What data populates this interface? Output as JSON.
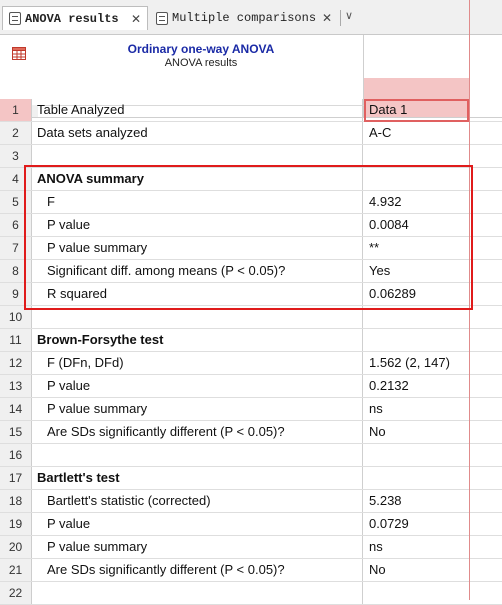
{
  "tabs": [
    {
      "label": "ANOVA results",
      "active": true,
      "icon": "table-icon"
    },
    {
      "label": "Multiple comparisons",
      "active": false,
      "icon": "table-icon"
    }
  ],
  "tab_close_glyph": "✕",
  "tab_menu_glyph": "∨",
  "header": {
    "title": "Ordinary one-way ANOVA",
    "subtitle": "ANOVA results",
    "corner_icon": "grid-table-icon"
  },
  "colors": {
    "accent_text": "#1a2aa6",
    "selected_row": "#f4c5c5",
    "highlight_border": "#e01b1b"
  },
  "rows": [
    {
      "num": "1",
      "label": "Table Analyzed",
      "value": "Data 1",
      "style": "plain",
      "selected": true
    },
    {
      "num": "2",
      "label": "Data sets analyzed",
      "value": "A-C",
      "style": "plain"
    },
    {
      "num": "3",
      "label": "",
      "value": "",
      "style": "plain"
    },
    {
      "num": "4",
      "label": "ANOVA summary",
      "value": "",
      "style": "head"
    },
    {
      "num": "5",
      "label": "F",
      "value": "4.932",
      "style": "sub"
    },
    {
      "num": "6",
      "label": "P value",
      "value": "0.0084",
      "style": "sub"
    },
    {
      "num": "7",
      "label": "P value summary",
      "value": "**",
      "style": "sub"
    },
    {
      "num": "8",
      "label": "Significant diff. among means (P < 0.05)?",
      "value": "Yes",
      "style": "sub"
    },
    {
      "num": "9",
      "label": "R squared",
      "value": "0.06289",
      "style": "sub"
    },
    {
      "num": "10",
      "label": "",
      "value": "",
      "style": "plain"
    },
    {
      "num": "11",
      "label": "Brown-Forsythe test",
      "value": "",
      "style": "head"
    },
    {
      "num": "12",
      "label": "F (DFn, DFd)",
      "value": "1.562 (2, 147)",
      "style": "sub"
    },
    {
      "num": "13",
      "label": "P value",
      "value": "0.2132",
      "style": "sub"
    },
    {
      "num": "14",
      "label": "P value summary",
      "value": "ns",
      "style": "sub"
    },
    {
      "num": "15",
      "label": "Are SDs significantly different (P < 0.05)?",
      "value": "No",
      "style": "sub"
    },
    {
      "num": "16",
      "label": "",
      "value": "",
      "style": "plain"
    },
    {
      "num": "17",
      "label": "Bartlett's test",
      "value": "",
      "style": "head"
    },
    {
      "num": "18",
      "label": "Bartlett's statistic (corrected)",
      "value": "5.238",
      "style": "sub"
    },
    {
      "num": "19",
      "label": "P value",
      "value": "0.0729",
      "style": "sub"
    },
    {
      "num": "20",
      "label": "P value summary",
      "value": "ns",
      "style": "sub"
    },
    {
      "num": "21",
      "label": "Are SDs significantly different (P < 0.05)?",
      "value": "No",
      "style": "sub"
    },
    {
      "num": "22",
      "label": "",
      "value": "",
      "style": "plain"
    }
  ]
}
